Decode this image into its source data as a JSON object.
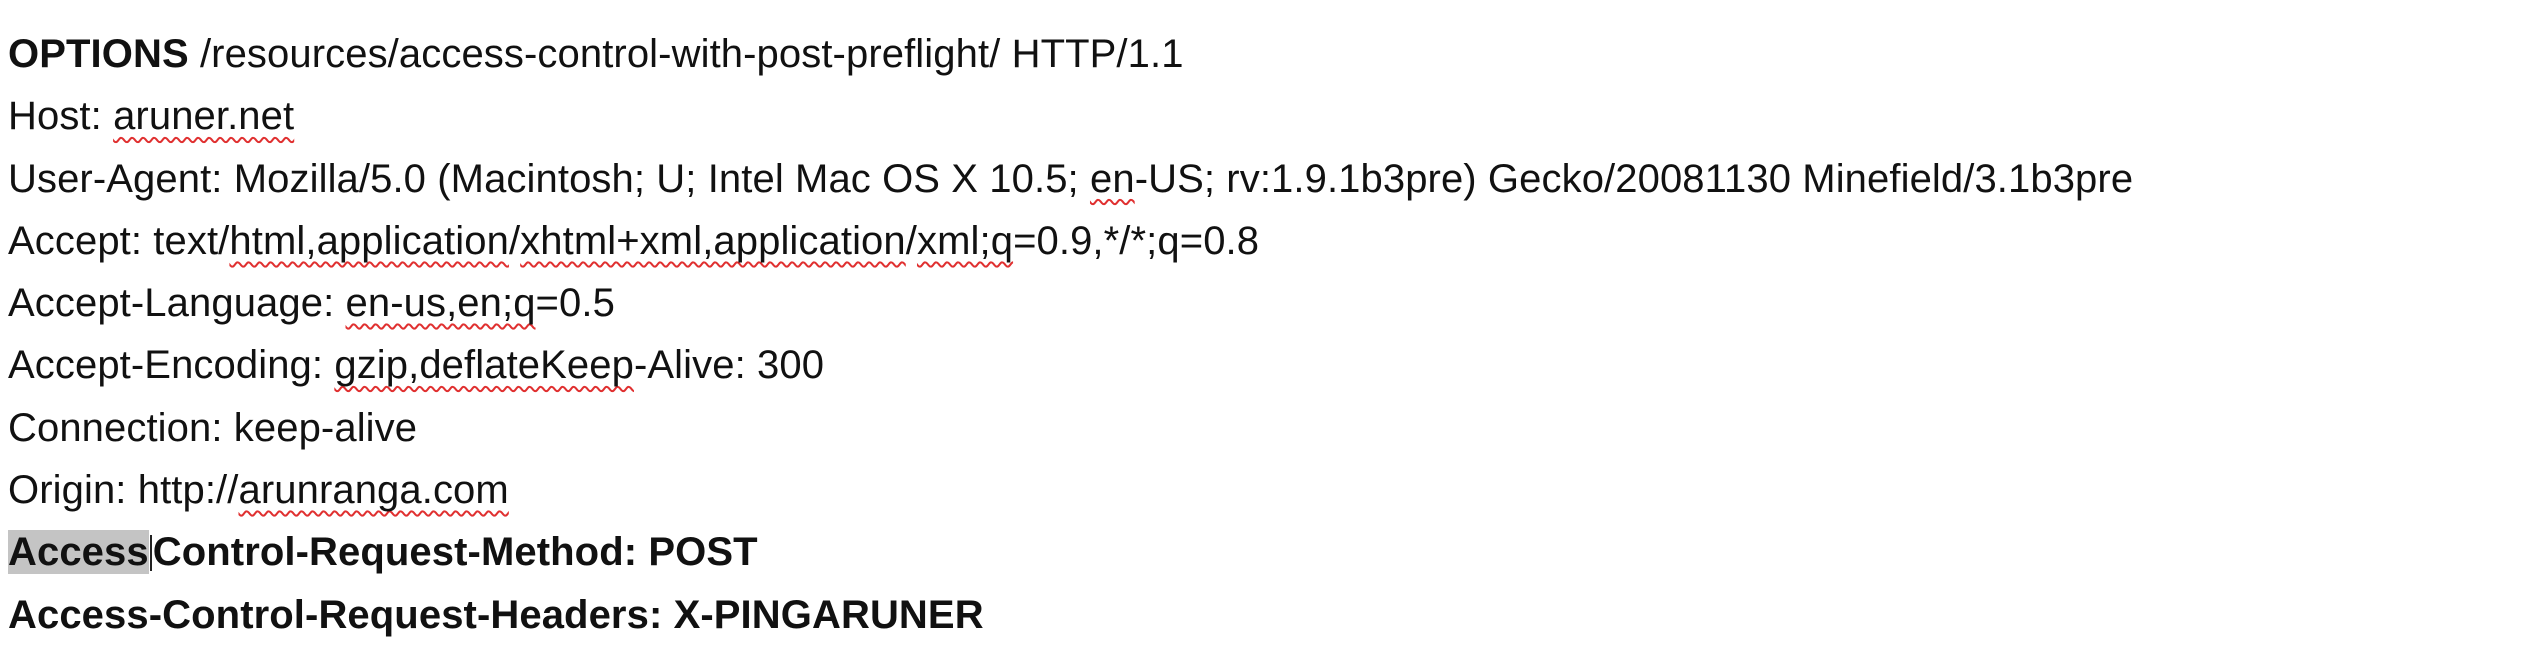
{
  "request": {
    "line1": {
      "method": "OPTIONS",
      "path": " /resources/access-control-with-post-preflight/ HTTP/1.1"
    },
    "line2": {
      "label": "Host: ",
      "value": "aruner.net"
    },
    "line3": {
      "a": "User-Agent: Mozilla/5.0 (Macintosh; U; Intel Mac OS X 10.5; ",
      "b": "en",
      "c": "-US; rv:1.9.1b3pre) Gecko/20081130 Minefield/3.1b3pre"
    },
    "line4": {
      "a": "Accept: text/",
      "b": "html,application",
      "c": "/",
      "d": "xhtml+xml,application",
      "e": "/",
      "f": "xml;q",
      "g": "=0.9,*/*;q=0.8"
    },
    "line5": {
      "a": "Accept-Language: ",
      "b": "en-us,en;q",
      "c": "=0.5"
    },
    "line6": {
      "a": "Accept-Encoding: ",
      "b": "gzip,deflateKeep",
      "c": "-Alive: 300"
    },
    "line7": {
      "text": "Connection: keep-alive"
    },
    "line8": {
      "a": "Origin: http://",
      "b": "arunranga.com"
    },
    "line9": {
      "selected": "Access",
      "rest": "Control-Request-Method: POST"
    },
    "line10": {
      "text": "Access-Control-Request-Headers: X-PINGARUNER"
    }
  },
  "colors": {
    "spellcheck_underline": "#e03030",
    "selection": "#c4c4c4",
    "text": "#111111"
  }
}
